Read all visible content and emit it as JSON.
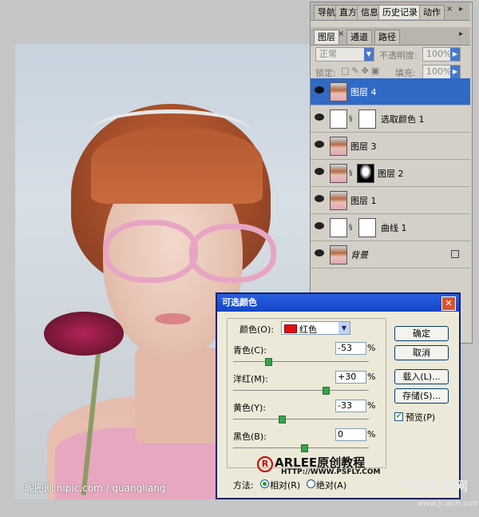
{
  "photo": {
    "credit": "昵图网 nipic.com / guangliang"
  },
  "history_panel": {
    "tabs": [
      "导航",
      "直方",
      "信息",
      "历史记录",
      "动作"
    ],
    "active_tab": "历史记录"
  },
  "layers_panel": {
    "tabs": [
      "图层",
      "通道",
      "路径"
    ],
    "blend_mode": "正常",
    "opacity_label": "不透明度:",
    "opacity_value": "100%",
    "lock_label": "锁定:",
    "fill_label": "填充:",
    "fill_value": "100%",
    "layers": [
      {
        "name": "图层 4",
        "selected": true
      },
      {
        "name": "选取颜色 1",
        "selected": false
      },
      {
        "name": "图层 3",
        "selected": false
      },
      {
        "name": "图层 2",
        "selected": false
      },
      {
        "name": "图层 1",
        "selected": false
      },
      {
        "name": "曲线 1",
        "selected": false
      },
      {
        "name": "背景",
        "selected": false
      }
    ]
  },
  "dialog": {
    "title": "可选颜色",
    "colors_label": "颜色(O):",
    "colors_value": "红色",
    "cyan_label": "青色(C):",
    "cyan_value": "-53",
    "magenta_label": "洋红(M):",
    "magenta_value": "+30",
    "yellow_label": "黄色(Y):",
    "yellow_value": "-33",
    "black_label": "黑色(B):",
    "black_value": "0",
    "percent": "%",
    "ok": "确定",
    "cancel": "取消",
    "load": "载入(L)...",
    "save": "存储(S)...",
    "preview": "预览(P)",
    "method_label": "方法:",
    "relative": "相对(R)",
    "absolute": "绝对(A)",
    "brand": "ARLEE原创教程",
    "brand_url": "HTTP://WWW.PSFLY.COM"
  },
  "watermark": {
    "text": "中国教程网",
    "url": "www.jcwcn.com"
  }
}
